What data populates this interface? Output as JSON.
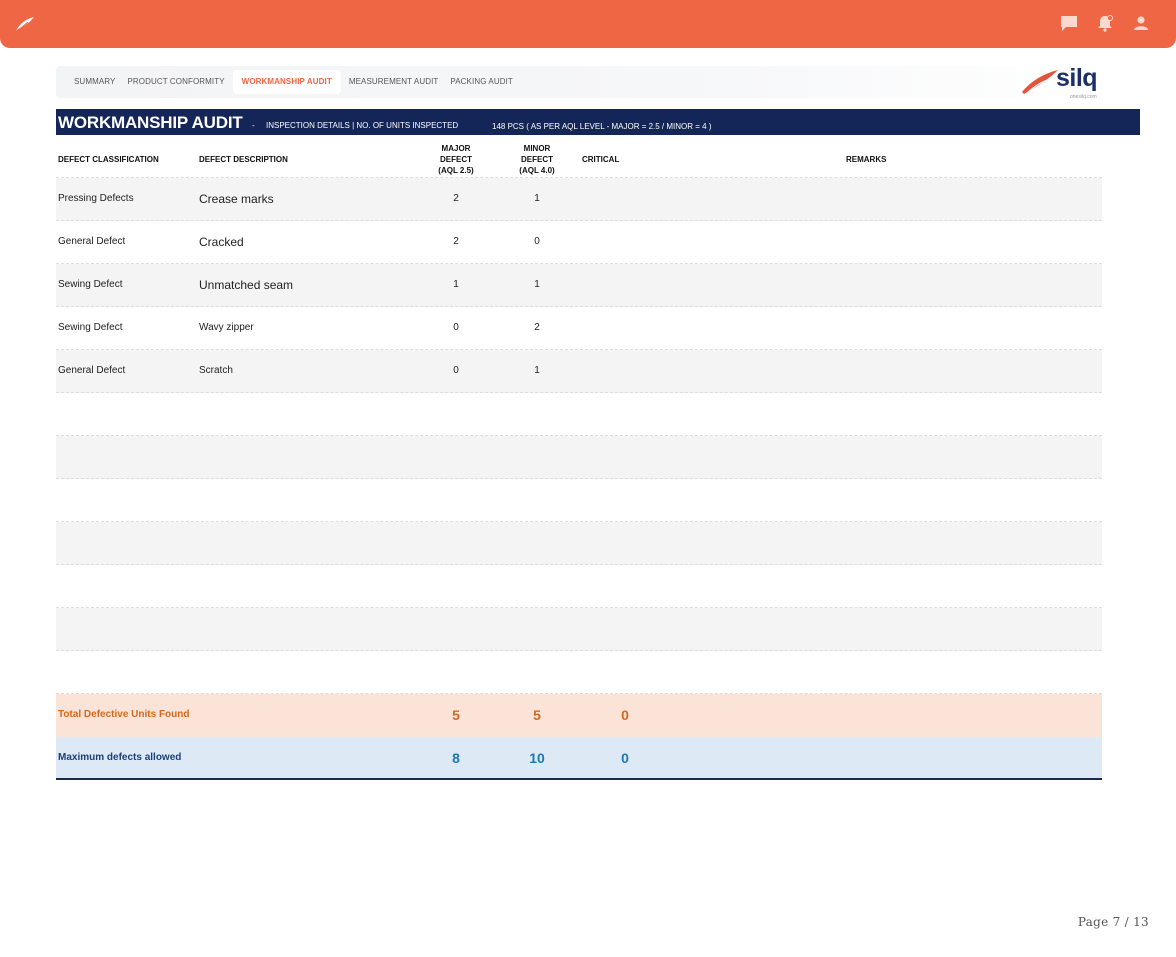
{
  "topbar": {
    "icons": [
      "leaf-logo-icon",
      "chat-icon",
      "notification-bell-icon",
      "user-icon"
    ],
    "accent_color": "#ef6645"
  },
  "tabs": [
    {
      "label": "SUMMARY",
      "active": false
    },
    {
      "label": "PRODUCT CONFORMITY",
      "active": false
    },
    {
      "label": "WORKMANSHIP AUDIT",
      "active": true
    },
    {
      "label": "MEASUREMENT AUDIT",
      "active": false
    },
    {
      "label": "PACKING AUDIT",
      "active": false
    }
  ],
  "logo": {
    "text": "silq",
    "subtext": "onesilq.com"
  },
  "section": {
    "title": "WORKMANSHIP AUDIT",
    "dash": "-",
    "info": "INSPECTION DETAILS | NO. OF UNITS INSPECTED",
    "units": "148  PCS ( AS PER AQL LEVEL -  MAJOR = 2.5 / MINOR = 4 )"
  },
  "table": {
    "headers": {
      "classification": "DEFECT CLASSIFICATION",
      "description": "DEFECT DESCRIPTION",
      "major": [
        "MAJOR",
        "DEFECT",
        "(AQL 2.5)"
      ],
      "minor": [
        "MINOR",
        "DEFECT",
        "(AQL 4.0)"
      ],
      "critical": "CRITICAL",
      "remarks": "REMARKS"
    },
    "rows": [
      {
        "classification": "Pressing Defects",
        "description": "Crease marks",
        "major": "2",
        "minor": "1"
      },
      {
        "classification": "General Defect",
        "description": "Cracked",
        "major": "2",
        "minor": "0"
      },
      {
        "classification": "Sewing Defect",
        "description": "Unmatched seam",
        "major": "1",
        "minor": "1"
      },
      {
        "classification": "Sewing Defect",
        "description": "Wavy zipper",
        "major": "0",
        "minor": "2"
      },
      {
        "classification": "General Defect",
        "description": "Scratch",
        "major": "0",
        "minor": "1"
      }
    ],
    "total": {
      "label": "Total Defective Units Found",
      "major": "5",
      "minor": "5",
      "critical": "0"
    },
    "max": {
      "label": "Maximum defects allowed",
      "major": "8",
      "minor": "10",
      "critical": "0"
    }
  },
  "footer": {
    "page": "Page 7 / 13"
  }
}
